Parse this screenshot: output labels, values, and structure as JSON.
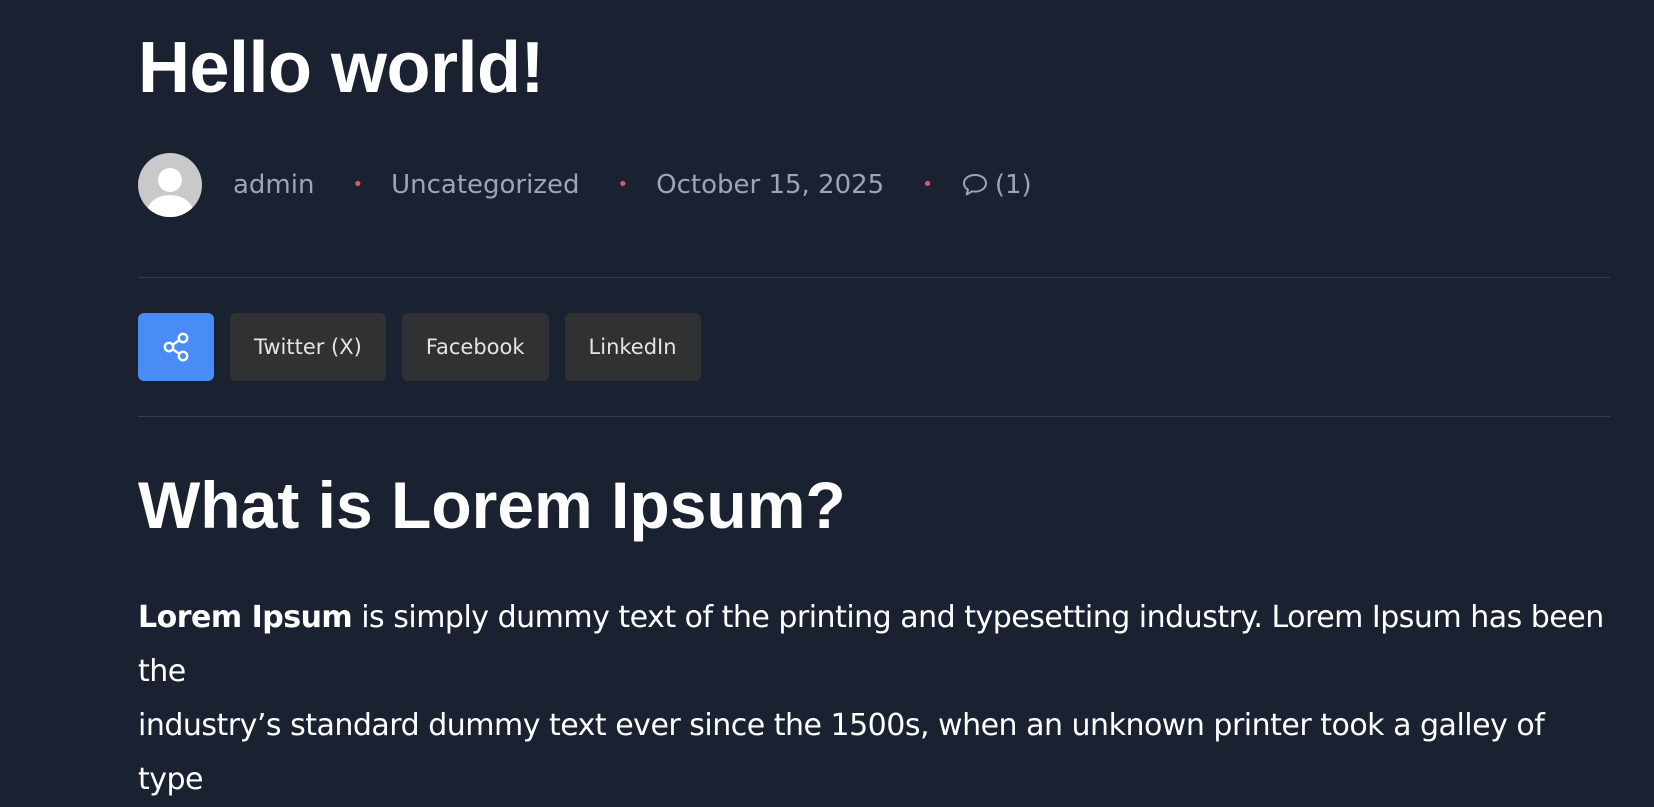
{
  "post": {
    "title": "Hello world!",
    "meta": {
      "author": "admin",
      "category": "Uncategorized",
      "date": "October 15, 2025",
      "comments": "(1)",
      "separator": "•"
    }
  },
  "share": {
    "icon": "share-icon",
    "buttons": [
      "Twitter (X)",
      "Facebook",
      "LinkedIn"
    ]
  },
  "content": {
    "heading": "What is Lorem Ipsum?",
    "paragraph_bold": "Lorem Ipsum",
    "paragraph_line1": " is simply dummy text of the printing and typesetting industry. Lorem Ipsum has been the",
    "paragraph_line2": "industry’s standard dummy text ever since the 1500s, when an unknown printer took a galley of type"
  },
  "colors": {
    "background": "#1a2130",
    "accent": "#4a8cf7",
    "separator": "#e0546c",
    "meta_text": "#9ba5b7"
  }
}
